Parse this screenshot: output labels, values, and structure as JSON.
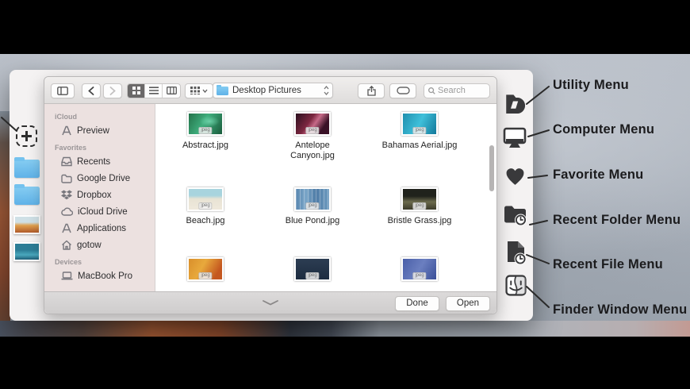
{
  "annotations": {
    "items": [
      {
        "label": "Utility Menu",
        "icon": "utility-menu-icon"
      },
      {
        "label": "Computer Menu",
        "icon": "computer-menu-icon"
      },
      {
        "label": "Favorite Menu",
        "icon": "favorite-menu-icon"
      },
      {
        "label": "Recent Folder Menu",
        "icon": "recent-folder-menu-icon"
      },
      {
        "label": "Recent File Menu",
        "icon": "recent-file-menu-icon"
      },
      {
        "label": "Finder Window Menu",
        "icon": "finder-window-menu-icon"
      }
    ]
  },
  "dialog": {
    "toolbar": {
      "path_dropdown": "Desktop Pictures",
      "search_placeholder": "Search"
    },
    "sidebar": {
      "sections": [
        {
          "title": "iCloud",
          "items": [
            {
              "label": "Preview"
            }
          ]
        },
        {
          "title": "Favorites",
          "items": [
            {
              "label": "Recents"
            },
            {
              "label": "Google Drive"
            },
            {
              "label": "Dropbox"
            },
            {
              "label": "iCloud Drive"
            },
            {
              "label": "Applications"
            },
            {
              "label": "gotow"
            }
          ]
        },
        {
          "title": "Devices",
          "items": [
            {
              "label": "MacBook Pro"
            }
          ]
        }
      ]
    },
    "files": {
      "badge": "jpeg",
      "items": [
        {
          "name": "Abstract.jpg"
        },
        {
          "name": "Antelope Canyon.jpg"
        },
        {
          "name": "Bahamas Aerial.jpg"
        },
        {
          "name": "Beach.jpg"
        },
        {
          "name": "Blue Pond.jpg"
        },
        {
          "name": "Bristle Grass.jpg"
        },
        {
          "name": ""
        },
        {
          "name": ""
        },
        {
          "name": ""
        }
      ]
    },
    "footer": {
      "done_label": "Done",
      "open_label": "Open"
    }
  },
  "colors": {
    "folder_blue": "#5fb2e8",
    "annotation_text": "#1b1b1d",
    "menu_icon": "#39393b",
    "sidebar_tint": "#ece1e0"
  }
}
